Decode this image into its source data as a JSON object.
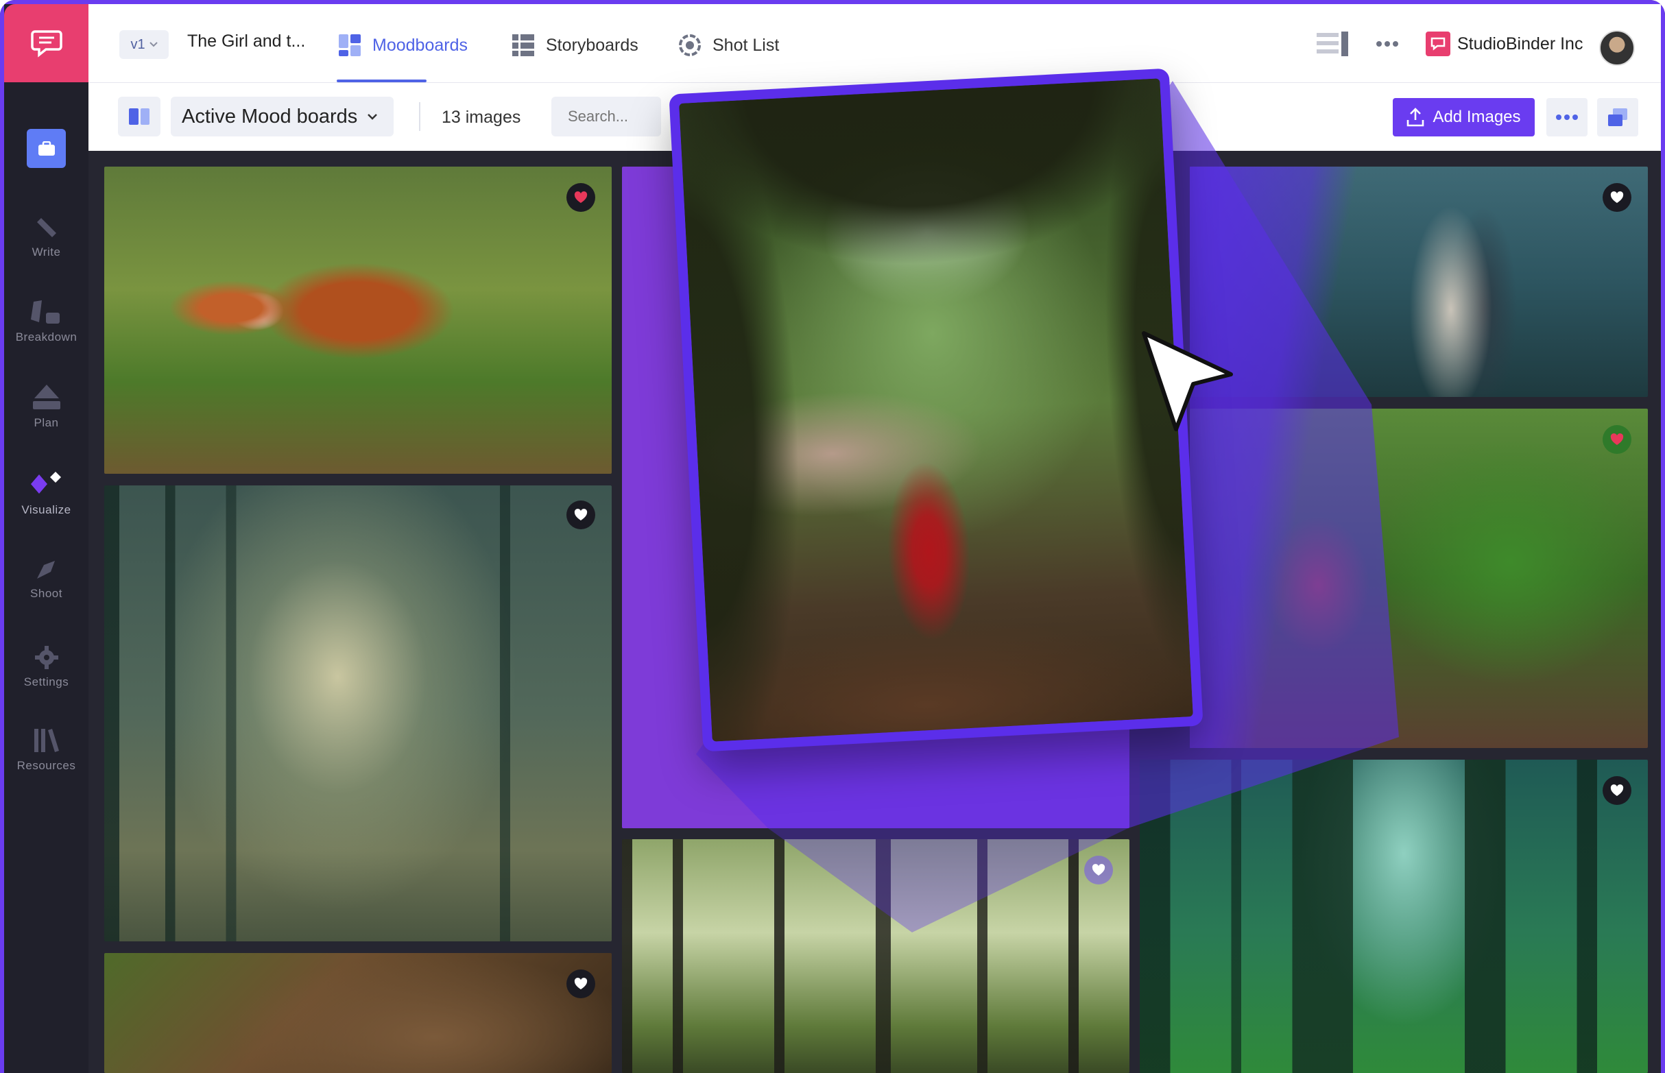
{
  "app": {
    "version_label": "v1",
    "project_title": "The Girl and t...",
    "brand_color": "#6a3cf0",
    "accent_color": "#4f63e6",
    "logo_color": "#e83e6f"
  },
  "sidebar": {
    "items": [
      {
        "label": "Write",
        "icon": "pen-icon"
      },
      {
        "label": "Breakdown",
        "icon": "breakdown-icon"
      },
      {
        "label": "Plan",
        "icon": "plan-icon"
      },
      {
        "label": "Visualize",
        "icon": "visualize-icon"
      },
      {
        "label": "Shoot",
        "icon": "shoot-icon"
      },
      {
        "label": "Settings",
        "icon": "gear-icon"
      },
      {
        "label": "Resources",
        "icon": "resources-icon"
      }
    ]
  },
  "header": {
    "tabs": [
      {
        "label": "Moodboards",
        "icon": "moodboards-icon",
        "active": true
      },
      {
        "label": "Storyboards",
        "icon": "storyboards-icon",
        "active": false
      },
      {
        "label": "Shot List",
        "icon": "shot-list-icon",
        "active": false
      }
    ],
    "org_name": "StudioBinder Inc"
  },
  "toolbar": {
    "board_select": "Active Mood boards",
    "image_count": "13 images",
    "search_placeholder": "Search...",
    "add_images_label": "Add Images"
  },
  "gallery": {
    "images": [
      {
        "name": "fox-in-grass",
        "favorited": true
      },
      {
        "name": "foggy-forest",
        "favorited": true
      },
      {
        "name": "forest-floor",
        "favorited": true
      },
      {
        "name": "forest-trees",
        "favorited": true
      },
      {
        "name": "women-in-forest",
        "favorited": true
      },
      {
        "name": "fox-in-bushes",
        "favorited": true
      },
      {
        "name": "green-forest",
        "favorited": true
      }
    ],
    "dragging_image": "girl-in-red-cloak"
  }
}
